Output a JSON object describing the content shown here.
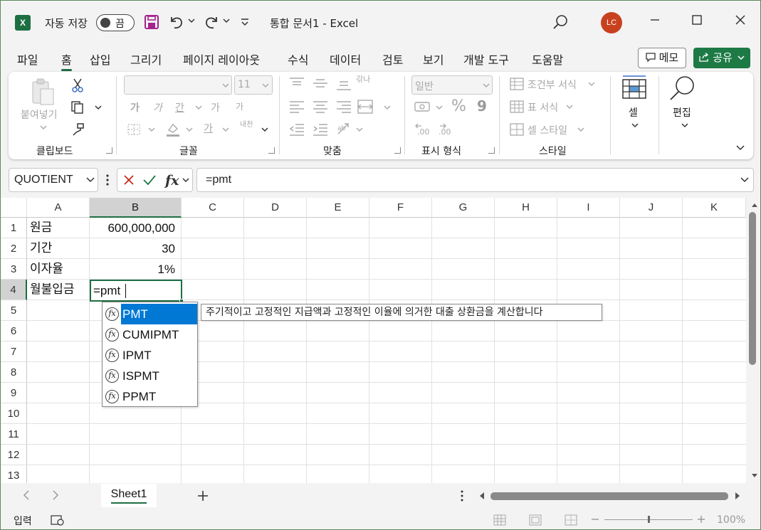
{
  "titlebar": {
    "autosave_label": "자동 저장",
    "toggle_state": "끔",
    "doc_title": "통합 문서1  -  Excel",
    "avatar_initials": "LC"
  },
  "menu": {
    "tabs": [
      "파일",
      "홈",
      "삽입",
      "그리기",
      "페이지 레이아웃",
      "수식",
      "데이터",
      "검토",
      "보기",
      "개발 도구",
      "도움말"
    ],
    "memo_label": "메모",
    "share_label": "공유"
  },
  "ribbon": {
    "clipboard": {
      "paste_label": "붙여넣기",
      "group_label": "클립보드"
    },
    "font": {
      "font_size": "11",
      "group_label": "글꼴",
      "bold": "가",
      "italic": "가",
      "underline": "간",
      "grow": "가",
      "shrink": "가",
      "fontcolor": "가",
      "phonetic": "내천"
    },
    "alignment": {
      "group_label": "맞춤",
      "wrap": "갂나"
    },
    "number": {
      "format": "일반",
      "group_label": "표시 형식",
      "percent": "%",
      "comma": "9",
      "inc_decimal": ".00",
      "dec_decimal": ".00"
    },
    "styles": {
      "cond_format": "조건부 서식",
      "table_format": "표 서식",
      "cell_styles": "셀 스타일",
      "group_label": "스타일"
    },
    "cells": {
      "label": "셀"
    },
    "editing": {
      "label": "편집"
    }
  },
  "formula_bar": {
    "name_box": "QUOTIENT",
    "formula": "=pmt"
  },
  "sheet": {
    "columns": [
      "A",
      "B",
      "C",
      "D",
      "E",
      "F",
      "G",
      "H",
      "I",
      "J",
      "K"
    ],
    "rows": [
      "1",
      "2",
      "3",
      "4",
      "5",
      "6",
      "7",
      "8",
      "9",
      "10",
      "11",
      "12",
      "13"
    ],
    "cells": {
      "a1": "원금",
      "b1": "600,000,000",
      "a2": "기간",
      "b2": "30",
      "a3": "이자율",
      "b3": "1%",
      "a4": "월불입금",
      "b4": "=pmt"
    }
  },
  "autocomplete": {
    "items": [
      "PMT",
      "CUMIPMT",
      "IPMT",
      "ISPMT",
      "PPMT"
    ],
    "tooltip": "주기적이고 고정적인 지급액과 고정적인 이율에 의거한 대출 상환금을 계산합니다"
  },
  "sheet_tabs": {
    "active": "Sheet1"
  },
  "statusbar": {
    "mode": "입력",
    "zoom": "100%"
  },
  "colors": {
    "accent": "#1d6f42",
    "highlight": "#0078d4",
    "avatar": "#c8411f"
  }
}
